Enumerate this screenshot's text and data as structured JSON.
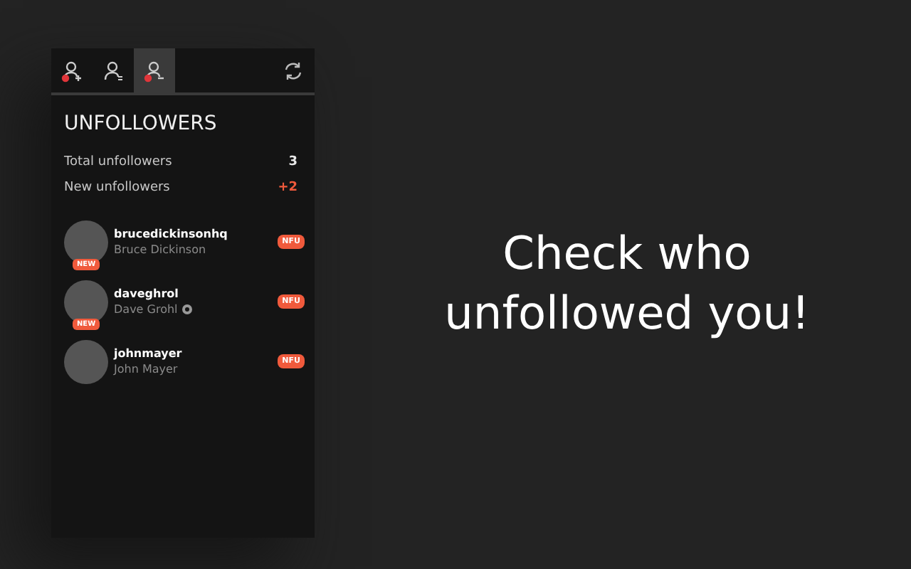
{
  "tabs": [
    {
      "kind": "add",
      "selected": false,
      "alert": true
    },
    {
      "kind": "list",
      "selected": false,
      "alert": false
    },
    {
      "kind": "remove",
      "selected": true,
      "alert": true
    }
  ],
  "title": "UNFOLLOWERS",
  "stats": [
    {
      "label": "Total unfollowers",
      "value": "3",
      "highlight": false
    },
    {
      "label": "New unfollowers",
      "value": "+2",
      "highlight": true
    }
  ],
  "users": [
    {
      "username": "brucedickinsonhq",
      "name": "Bruce Dickinson",
      "new": true,
      "verified": false,
      "new_badge": "NEW",
      "tag": "NFU"
    },
    {
      "username": "daveghrol",
      "name": "Dave Grohl",
      "new": true,
      "verified": true,
      "new_badge": "NEW",
      "tag": "NFU"
    },
    {
      "username": "johnmayer",
      "name": "John Mayer",
      "new": false,
      "verified": false,
      "tag": "NFU"
    }
  ],
  "tagline": "Check who unfollowed you!"
}
